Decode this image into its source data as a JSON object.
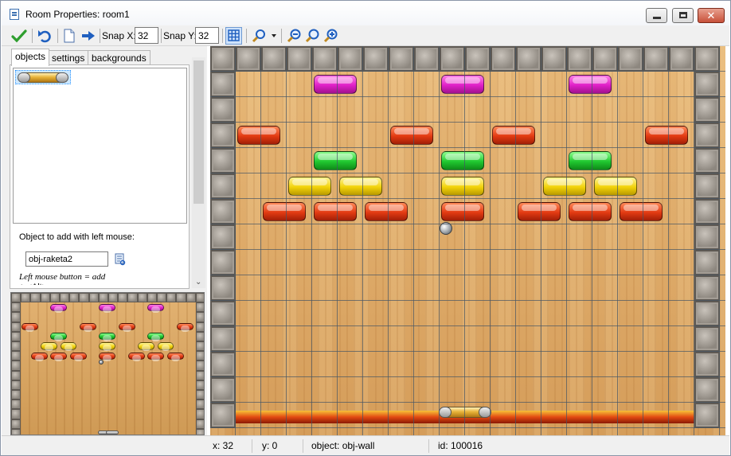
{
  "window": {
    "title": "Room Properties: room1"
  },
  "toolbar": {
    "snap_x_label": "Snap X:",
    "snap_x_value": "32",
    "snap_y_label": "Snap Y:",
    "snap_y_value": "32"
  },
  "tabs": [
    "objects",
    "settings",
    "backgrounds"
  ],
  "objects_panel": {
    "add_label": "Object to add with left mouse:",
    "object_name": "obj-raketa2",
    "hint": "Left mouse button = add",
    "hint_more": "+ <Alt> = no snap"
  },
  "status": {
    "x": "x: 32",
    "y": "y: 0",
    "object": "object: obj-wall",
    "id": "id: 100016"
  },
  "colors": {
    "pink": "#e020c8",
    "red": "#e23a12",
    "green": "#20c830",
    "yellow": "#f2d20a"
  }
}
